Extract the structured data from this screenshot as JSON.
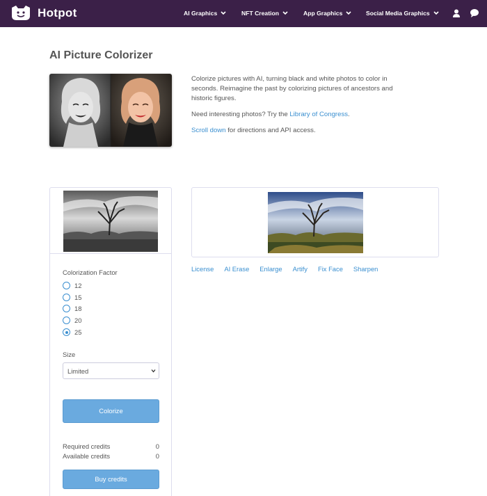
{
  "nav": {
    "brand": "Hotpot",
    "items": [
      "AI Graphics",
      "NFT Creation",
      "App Graphics",
      "Social Media Graphics"
    ]
  },
  "page": {
    "title": "AI Picture Colorizer",
    "intro": {
      "p1": "Colorize pictures with AI, turning black and white photos to color in seconds. Reimagine the past by colorizing pictures of ancestors and historic figures.",
      "p2_pre": "Need interesting photos? Try the ",
      "p2_link": "Library of Congress",
      "p2_post": ".",
      "p3_link": "Scroll down",
      "p3_post": " for directions and API access."
    }
  },
  "form": {
    "factor_label": "Colorization Factor",
    "factor_options": [
      "12",
      "15",
      "18",
      "20",
      "25"
    ],
    "factor_selected": "25",
    "size_label": "Size",
    "size_value": "Limited",
    "colorize_button": "Colorize",
    "required_credits_label": "Required credits",
    "required_credits_value": "0",
    "available_credits_label": "Available credits",
    "available_credits_value": "0",
    "buy_button": "Buy credits"
  },
  "tools": [
    "License",
    "AI Erase",
    "Enlarge",
    "Artify",
    "Fix Face",
    "Sharpen"
  ],
  "colors": {
    "nav_bg": "#3b2048",
    "accent": "#3a8fd0",
    "button": "#6aaadf"
  }
}
